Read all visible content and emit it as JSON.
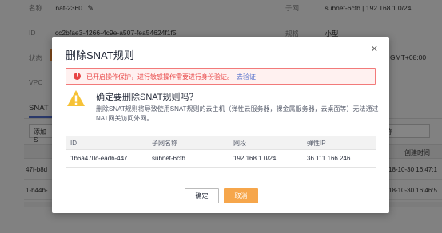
{
  "background": {
    "name_label": "名称",
    "name_value": "nat-2360",
    "id_label": "ID",
    "id_value": "cc2bfae3-4266-4c9e-a507-fea54624f1f5",
    "status_label": "状态",
    "vpc_label": "VPC",
    "subnet_label": "子网",
    "subnet_value": "subnet-6cfb | 192.168.1.0/24",
    "spec_label": "规格",
    "spec_value": "小型",
    "timezone_value": "GMT+08:00",
    "tab_label": "SNAT",
    "add_button_label": "添加S",
    "right_select_label": "称",
    "col_time": "创建时间",
    "row1_id": "47f-b8d",
    "row1_time": "18-10-30 16:47:1",
    "row2_id": "1-b44b-",
    "row2_time": "18-10-30 16:46:5"
  },
  "dialog": {
    "title": "删除SNAT规则",
    "alert_text": "已开启操作保护，进行敏感操作需要进行身份验证。",
    "alert_link": "去验证",
    "confirm_title": "确定要删除SNAT规则吗？",
    "confirm_desc": "删除SNAT规则将导致使用SNAT规则的云主机（弹性云服务器，裸金属服务器，云桌面等）无法通过NAT网关访问外网。",
    "table": {
      "headers": [
        "ID",
        "子网名称",
        "网段",
        "弹性IP"
      ],
      "rows": [
        [
          "1b6a470c-ead6-447...",
          "subnet-6cfb",
          "192.168.1.0/24",
          "36.111.166.246"
        ]
      ]
    },
    "ok_label": "确定",
    "cancel_label": "取消"
  },
  "colors": {
    "accent_orange": "#f6a64b",
    "link_blue": "#526ecc",
    "alert_red": "#e84545",
    "warn_yellow": "#f6c236"
  },
  "icons": [
    "pencil-icon",
    "close-icon",
    "error-icon",
    "warning-icon"
  ]
}
